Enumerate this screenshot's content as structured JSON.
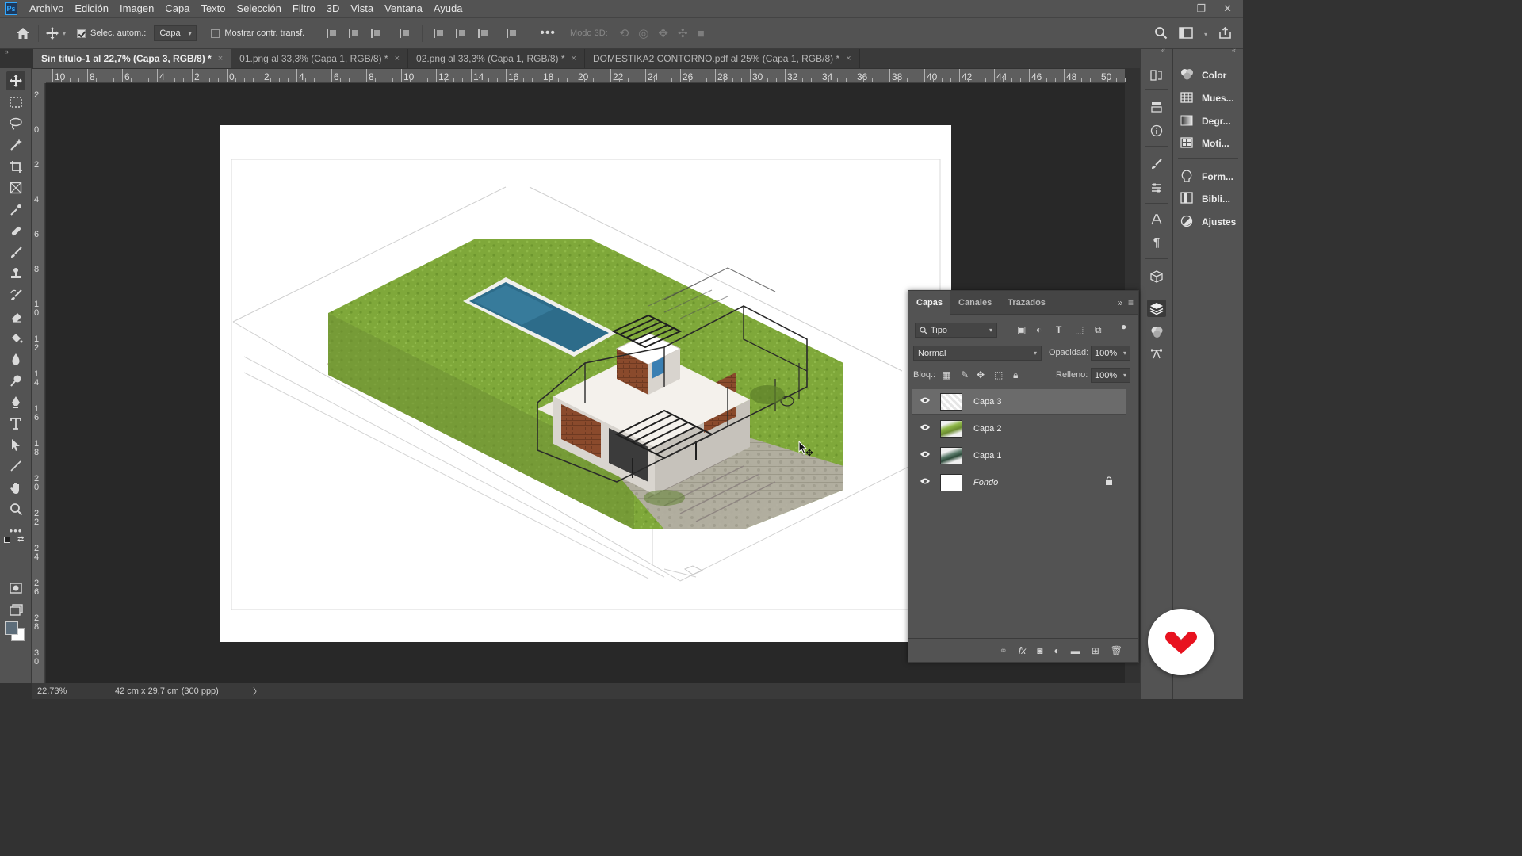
{
  "app": {
    "logo": "Ps"
  },
  "menu": [
    "Archivo",
    "Edición",
    "Imagen",
    "Capa",
    "Texto",
    "Selección",
    "Filtro",
    "3D",
    "Vista",
    "Ventana",
    "Ayuda"
  ],
  "window_controls": {
    "minimize": "–",
    "restore": "❐",
    "close": "✕"
  },
  "options_bar": {
    "auto_select_label": "Selec. autom.:",
    "auto_select_checked": true,
    "auto_select_target": "Capa",
    "show_transform_label": "Mostrar contr. transf.",
    "show_transform_checked": false,
    "mode_3d_label": "Modo 3D:"
  },
  "tabs": [
    {
      "label": "Sin título-1 al 22,7% (Capa 3, RGB/8) *",
      "active": true
    },
    {
      "label": "01.png al 33,3% (Capa 1, RGB/8) *",
      "active": false
    },
    {
      "label": "02.png al 33,3% (Capa 1, RGB/8) *",
      "active": false
    },
    {
      "label": "DOMESTIKA2 CONTORNO.pdf al 25% (Capa 1, RGB/8) *",
      "active": false
    }
  ],
  "tab_close": "×",
  "ruler_top": [
    "10",
    "8",
    "6",
    "4",
    "2",
    "0",
    "2",
    "4",
    "6",
    "8",
    "10",
    "12",
    "14",
    "16",
    "18",
    "20",
    "22",
    "24",
    "26",
    "28",
    "30",
    "32",
    "34",
    "36",
    "38",
    "40",
    "42",
    "44",
    "46",
    "48",
    "50"
  ],
  "ruler_left": [
    "2",
    "0",
    "2",
    "4",
    "6",
    "8",
    "10",
    "12",
    "14",
    "16",
    "18",
    "20",
    "22",
    "24",
    "26",
    "28",
    "30"
  ],
  "status": {
    "zoom": "22,73%",
    "doc_info": "42 cm x 29,7 cm (300 ppp)",
    "arrow": "〉"
  },
  "panels": [
    {
      "icon": "color-wheel-icon",
      "label": "Color"
    },
    {
      "icon": "swatches-icon",
      "label": "Mues..."
    },
    {
      "icon": "gradient-icon",
      "label": "Degr..."
    },
    {
      "icon": "pattern-icon",
      "label": "Moti..."
    },
    {
      "icon": "shapes-icon",
      "label": "Form..."
    },
    {
      "icon": "libraries-icon",
      "label": "Bibli..."
    },
    {
      "icon": "adjustments-icon",
      "label": "Ajustes"
    }
  ],
  "layers_panel": {
    "tabs": [
      "Capas",
      "Canales",
      "Trazados"
    ],
    "active_tab": "Capas",
    "filter_kind": "Tipo",
    "blend_mode": "Normal",
    "opacity_label": "Opacidad:",
    "opacity": "100%",
    "lock_label": "Bloq.:",
    "fill_label": "Relleno:",
    "fill": "100%",
    "layers": [
      {
        "name": "Capa 3",
        "selected": true,
        "visible": true,
        "locked": false,
        "italic": false
      },
      {
        "name": "Capa 2",
        "selected": false,
        "visible": true,
        "locked": false,
        "italic": false
      },
      {
        "name": "Capa 1",
        "selected": false,
        "visible": true,
        "locked": false,
        "italic": false
      },
      {
        "name": "Fondo",
        "selected": false,
        "visible": true,
        "locked": true,
        "italic": true
      }
    ]
  },
  "colors": {
    "ui_bg": "#535353",
    "workspace": "#282828",
    "selected_layer": "#6b6b6b",
    "brand": "#e8121f",
    "lawn": "#7fa83a",
    "pool": "#2d6c8a"
  }
}
